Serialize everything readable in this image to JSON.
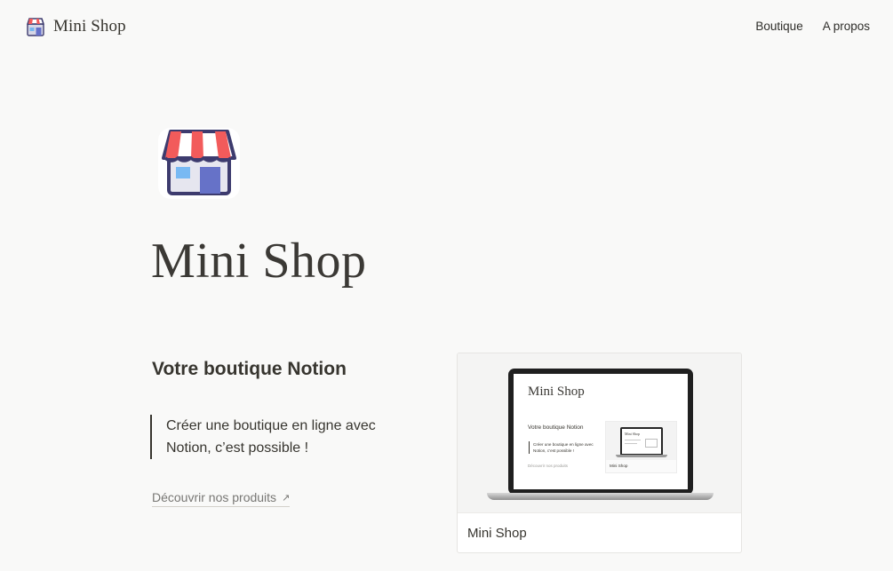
{
  "header": {
    "brand_label": "Mini Shop",
    "brand_icon": "store-icon",
    "nav": [
      {
        "label": "Boutique"
      },
      {
        "label": "A propos"
      }
    ]
  },
  "hero": {
    "icon": "store-icon",
    "title": "Mini Shop"
  },
  "content": {
    "subtitle": "Votre boutique Notion",
    "quote": "Créer une boutique en ligne avec Notion, c’est possible !",
    "cta_label": "Découvrir nos produits",
    "cta_icon": "arrow-up-right-icon"
  },
  "card": {
    "title": "Mini Shop",
    "cover": {
      "title": "Mini Shop",
      "subtitle": "Votre boutique Notion",
      "quote": "Créer une boutique en ligne avec Notion, c’est possible !",
      "cta_label": "Découvrir nos produits",
      "mini_card_title": "Mini Shop",
      "mini_card_cover_title": "Mini Shop"
    }
  },
  "colors": {
    "background": "#f9f9f8",
    "text": "#37352f",
    "awning_red": "#f25b5b",
    "awning_white": "#ffffff",
    "store_blue": "#9bc7f2",
    "door_blue": "#5c6bc0"
  }
}
